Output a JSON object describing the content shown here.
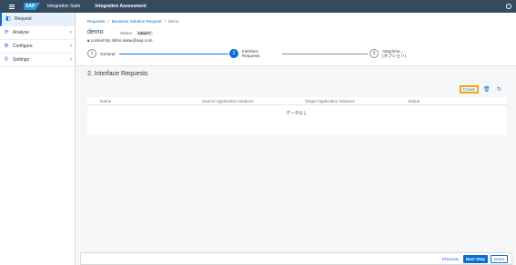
{
  "shell": {
    "logo": "SAP",
    "title": "Integration Suite",
    "subtitle": "Integration Assessment"
  },
  "sidebar": {
    "items": [
      {
        "label": "Request",
        "icon": "request-icon"
      },
      {
        "label": "Analyse",
        "icon": "analyse-icon"
      },
      {
        "label": "Configure",
        "icon": "configure-icon"
      },
      {
        "label": "Settings",
        "icon": "settings-icon"
      }
    ]
  },
  "breadcrumb": {
    "items": [
      "Requests",
      "Business Solution Request",
      "demo"
    ],
    "separator": "/"
  },
  "header": {
    "title": "demo",
    "status_label": "Status:",
    "status_value": "DRAFT",
    "locked_text": "Locked By shiho.sakai@sap.com"
  },
  "wizard": {
    "steps": [
      {
        "number": "1",
        "label": "General"
      },
      {
        "number": "2",
        "label": "Interface Requests"
      },
      {
        "number": "3",
        "label": "Attachme...",
        "label2": "(オプション)"
      }
    ]
  },
  "section": {
    "title": "2. Interface Requests"
  },
  "toolbar": {
    "create_label": "Create"
  },
  "table": {
    "columns": [
      "Name",
      "Source Application Instance",
      "Target Application Instance",
      "Status"
    ],
    "empty_text": "データなし"
  },
  "footer": {
    "previous": "Previous",
    "next": "Next Step",
    "done": "Done"
  },
  "colors": {
    "shell": "#354a5f",
    "accent": "#0a6ed1",
    "highlight": "#f0ab00"
  }
}
